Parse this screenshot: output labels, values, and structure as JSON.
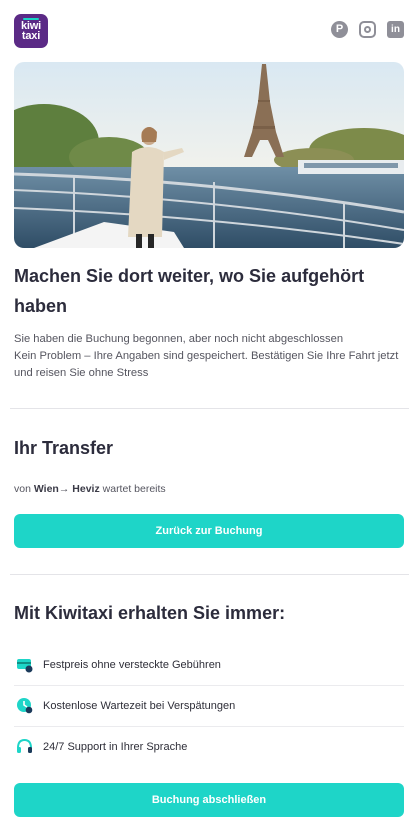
{
  "brand": {
    "logo_line1": "kiwi",
    "logo_line2": "taxi",
    "primary_color": "#1ed5c8",
    "logo_color": "#5b2a86"
  },
  "socials": [
    {
      "name": "pinterest",
      "glyph": "P"
    },
    {
      "name": "instagram",
      "glyph": ""
    },
    {
      "name": "linkedin",
      "glyph": "in"
    }
  ],
  "hero": {
    "title": "Machen Sie dort weiter, wo Sie aufgehört haben",
    "line1": "Sie haben die Buchung begonnen, aber noch nicht abgeschlossen",
    "line2": "Kein Problem – Ihre Angaben sind gespeichert. Bestätigen Sie Ihre Fahrt jetzt und reisen Sie ohne Stress"
  },
  "transfer": {
    "title": "Ihr Transfer",
    "prefix": "von",
    "from": "Wien",
    "arrow": "→",
    "to": "Heviz",
    "suffix": "wartet bereits",
    "button": "Zurück zur Buchung"
  },
  "features": {
    "title": "Mit Kiwitaxi erhalten Sie immer:",
    "items": [
      {
        "icon": "price-card-icon",
        "label": "Festpreis ohne versteckte Gebühren"
      },
      {
        "icon": "clock-check-icon",
        "label": "Kostenlose Wartezeit bei Verspätungen"
      },
      {
        "icon": "headphones-icon",
        "label": "24/7 Support in Ihrer Sprache"
      }
    ],
    "button": "Buchung abschließen"
  }
}
